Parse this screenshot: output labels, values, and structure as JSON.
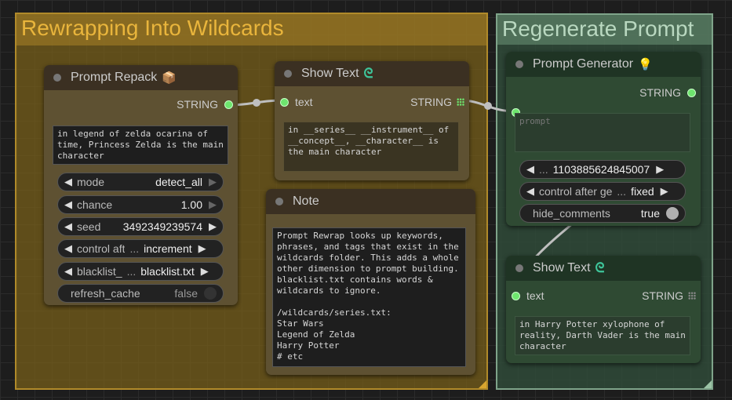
{
  "groups": {
    "wildcards_title": "Rewrapping Into Wildcards",
    "regenerate_title": "Regenerate Prompt"
  },
  "prompt_repack": {
    "title": "Prompt Repack",
    "icon": "package-emoji",
    "output_label": "STRING",
    "text": "in legend of zelda ocarina of time, Princess Zelda is the main character",
    "widgets": [
      {
        "label": "mode",
        "value": "detect_all"
      },
      {
        "label": "chance",
        "value": "1.00"
      },
      {
        "label": "seed",
        "value": "3492349239574"
      },
      {
        "label": "control aft",
        "value": "increment"
      },
      {
        "label": "blacklist_",
        "value": "blacklist.txt"
      },
      {
        "label": "refresh_cache",
        "value": "false"
      }
    ]
  },
  "show_text_1": {
    "title": "Show Text",
    "input_label": "text",
    "output_label": "STRING",
    "text": "in __series__ __instrument__ of __concept__, __character__ is the main character"
  },
  "note": {
    "title": "Note",
    "text": "Prompt Rewrap looks up keywords, phrases, and tags that exist in the wildcards folder. This adds a whole other dimension to prompt building. blacklist.txt contains words & wildcards to ignore.\n\n/wildcards/series.txt:\nStar Wars\nLegend of Zelda\nHarry Potter\n# etc"
  },
  "prompt_generator": {
    "title": "Prompt Generator",
    "icon": "lightbulb-emoji",
    "output_label": "STRING",
    "placeholder": "prompt",
    "seed_value": "1103885624845007",
    "control_label": "control after ge",
    "control_value": "fixed",
    "hide_label": "hide_comments",
    "hide_value": "true"
  },
  "show_text_2": {
    "title": "Show Text",
    "input_label": "text",
    "output_label": "STRING",
    "text": "in Harry Potter xylophone of reality, Darth Vader is the main character"
  },
  "colors": {
    "group_gold": "#b08a2a",
    "group_green": "#7fa48a",
    "slot_green": "#6ee56e",
    "swirl": "#3ec59a"
  }
}
